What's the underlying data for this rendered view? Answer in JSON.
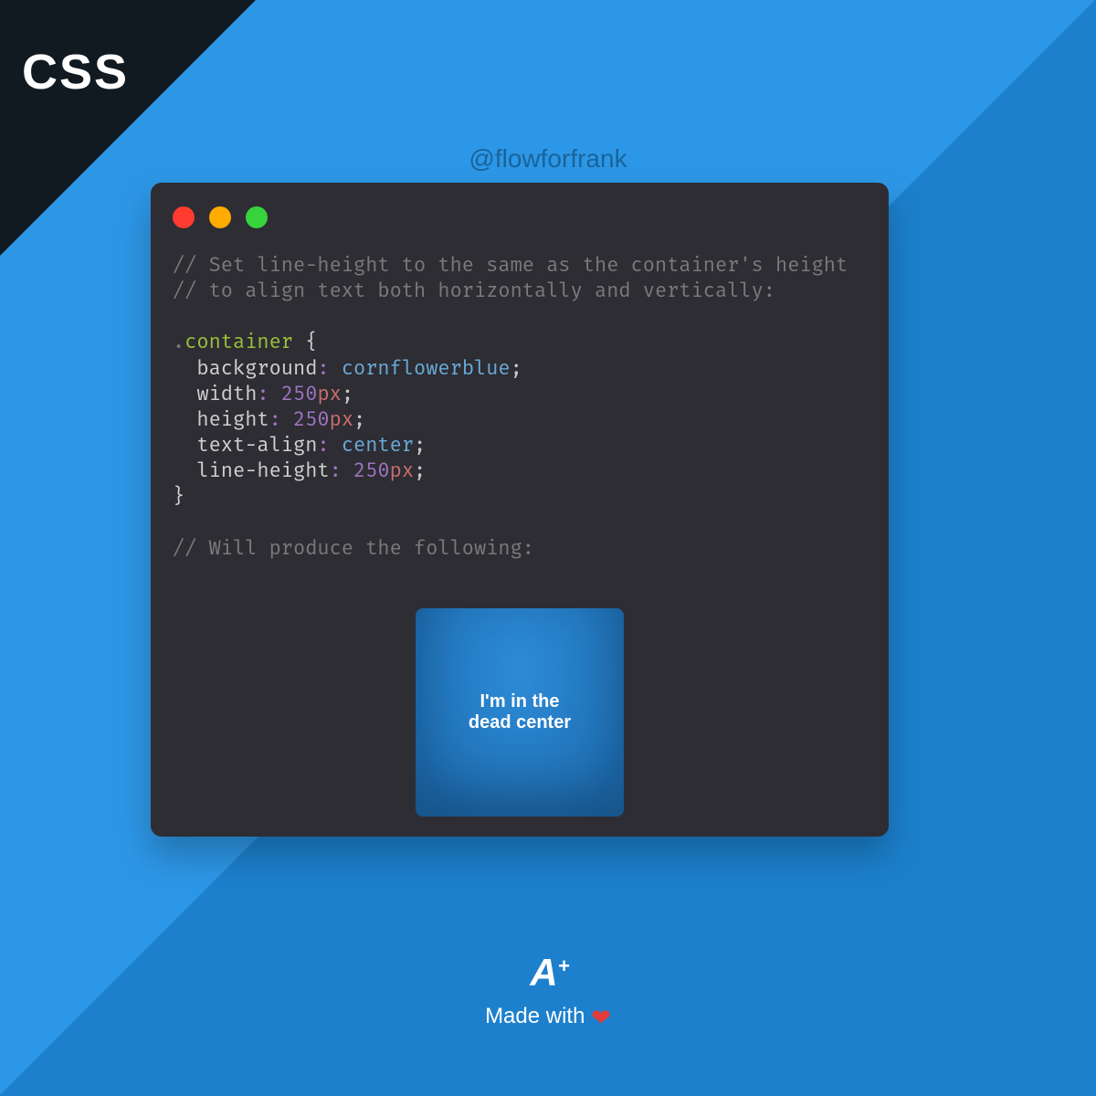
{
  "corner_label": "CSS",
  "handle": "@flowforfrank",
  "traffic_lights": [
    "red",
    "amber",
    "green"
  ],
  "code": {
    "comment1": "// Set line-height to the same as the container's height",
    "comment2": "// to align text both horizontally and vertically:",
    "selector": ".container",
    "rules": [
      {
        "prop": "background",
        "value": "cornflowerblue"
      },
      {
        "prop": "width",
        "num": "250",
        "unit": "px"
      },
      {
        "prop": "height",
        "num": "250",
        "unit": "px"
      },
      {
        "prop": "text-align",
        "value": "center"
      },
      {
        "prop": "line-height",
        "num": "250",
        "unit": "px"
      }
    ],
    "comment3": "// Will produce the following:"
  },
  "demo_line1": "I'm in the",
  "demo_line2": "dead center",
  "footer": {
    "logo": "A",
    "logo_plus": "+",
    "made": "Made with",
    "heart": "❤"
  }
}
